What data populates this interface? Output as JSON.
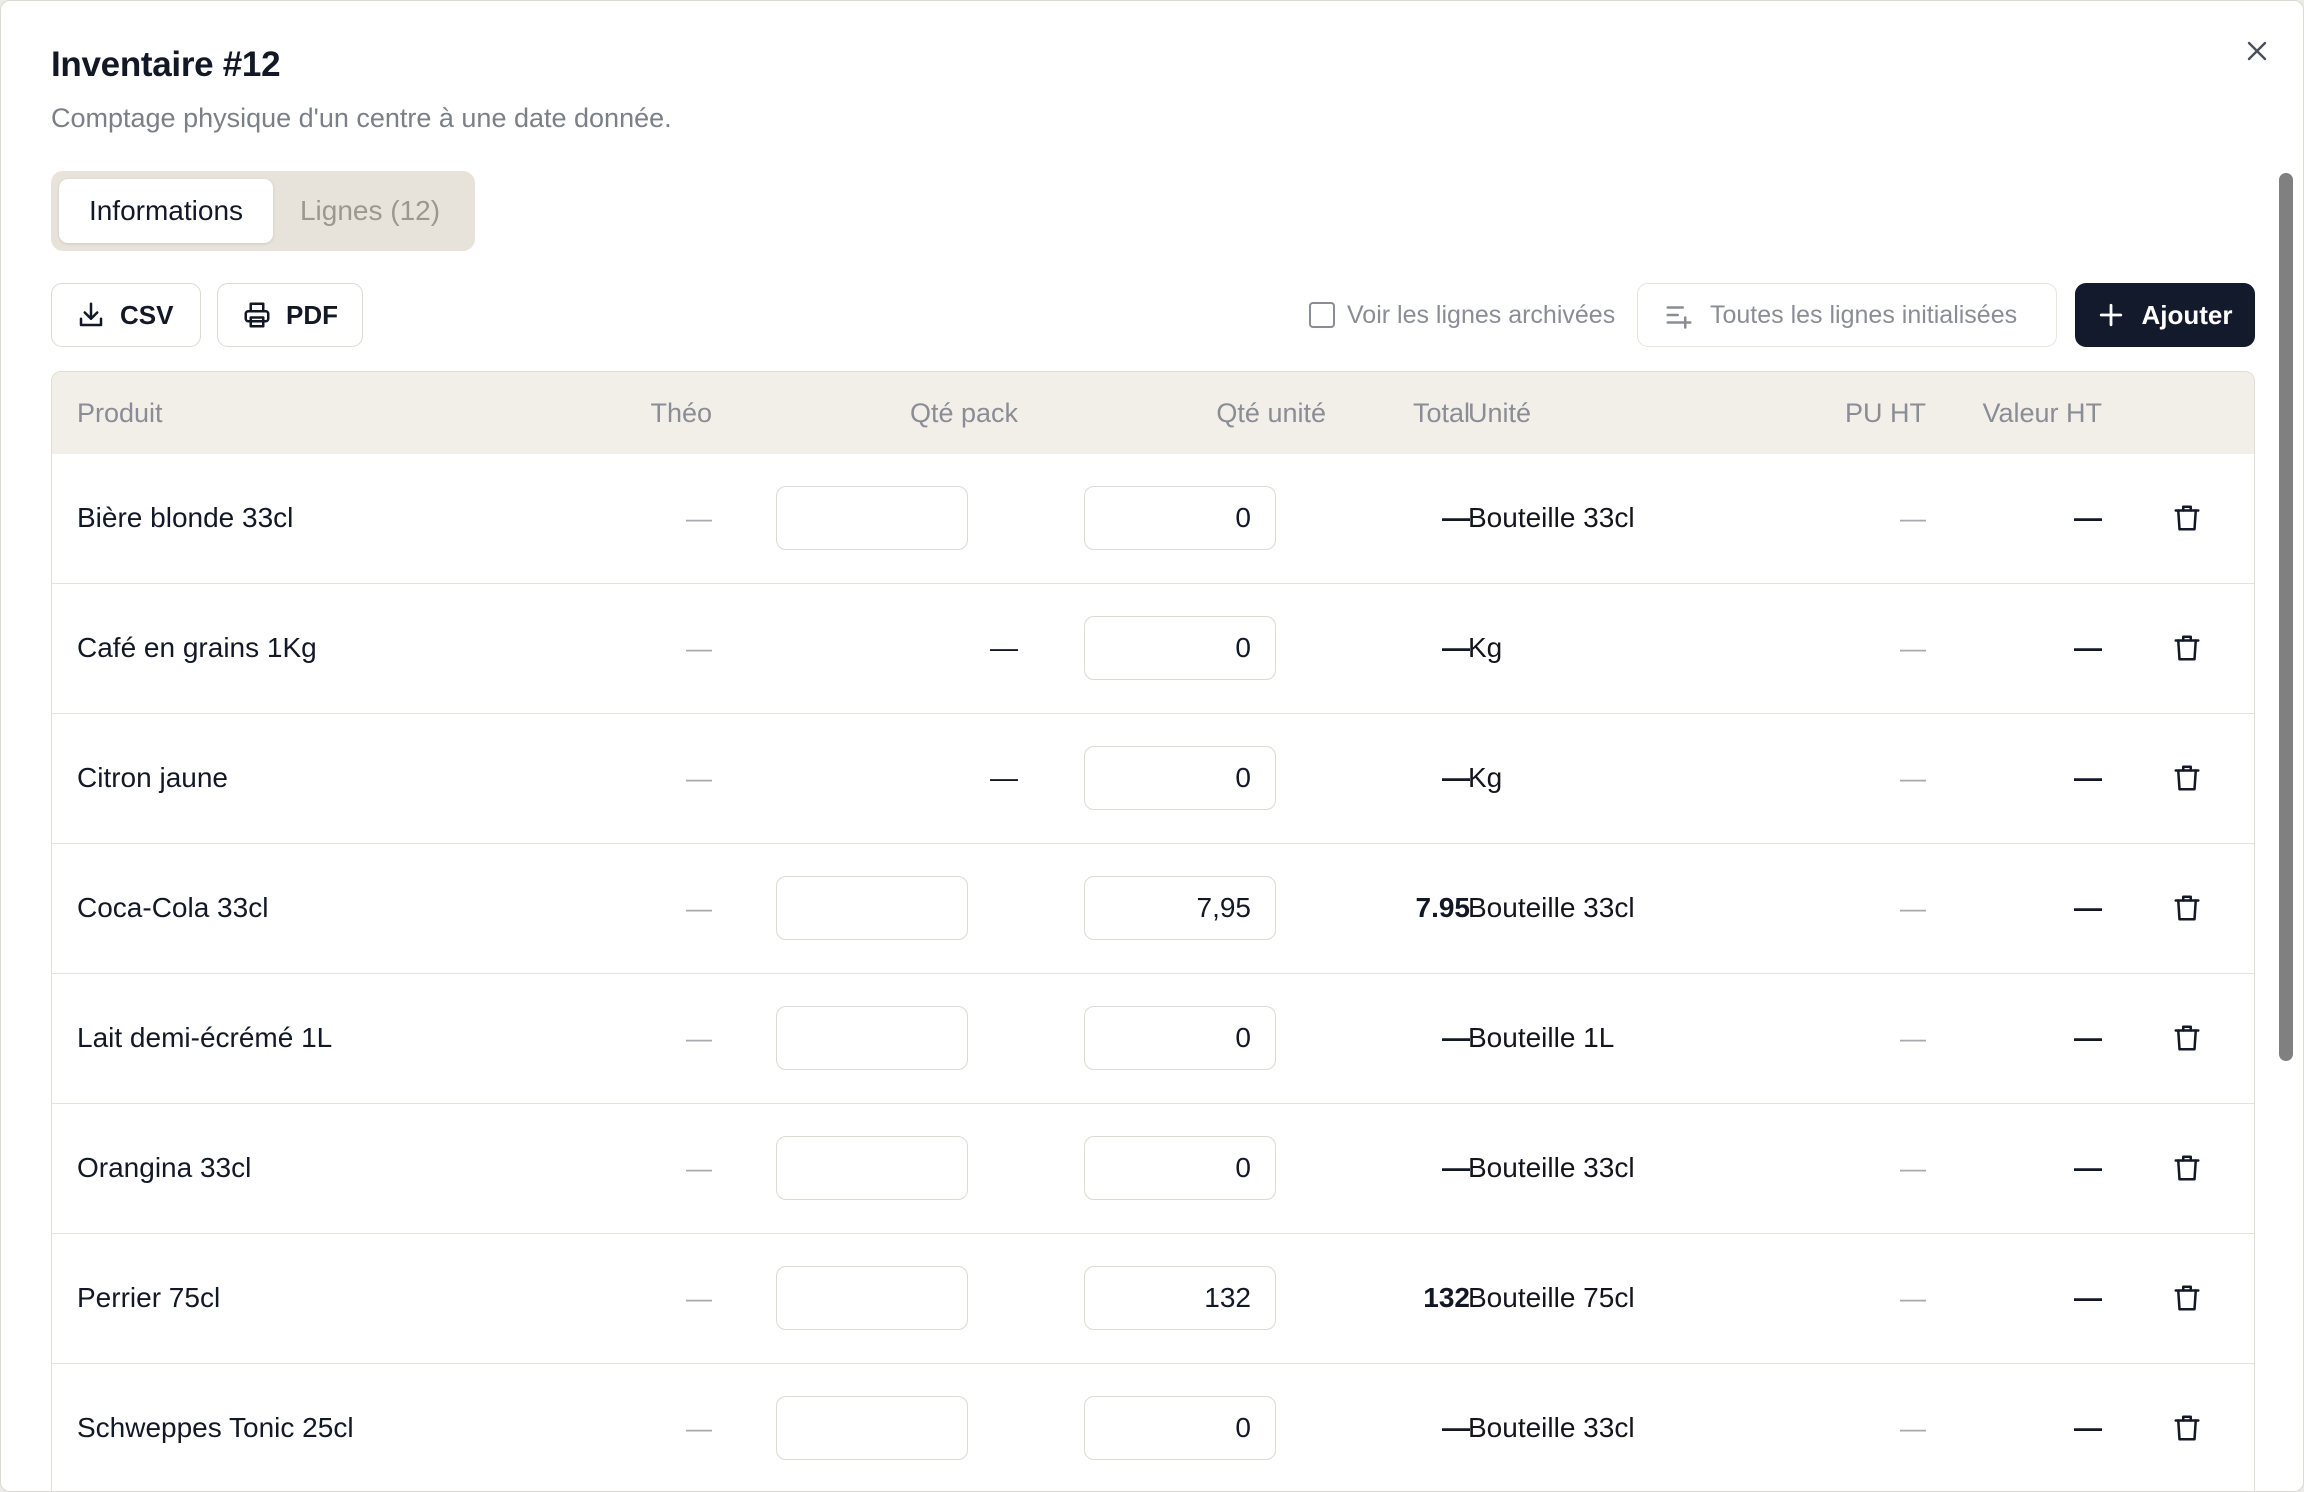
{
  "dialog": {
    "title": "Inventaire #12",
    "subtitle": "Comptage physique d'un centre à une date donnée."
  },
  "tabs": [
    {
      "label": "Informations",
      "active": true
    },
    {
      "label": "Lignes (12)",
      "active": false
    }
  ],
  "toolbar": {
    "csv_label": "CSV",
    "pdf_label": "PDF",
    "archived_label": "Voir les lignes archivées",
    "archived_checked": false,
    "filter_label": "Toutes les lignes initialisées",
    "add_label": "Ajouter"
  },
  "table": {
    "columns": [
      "Produit",
      "Théo",
      "Qté pack",
      "Qté unité",
      "Total",
      "Unité",
      "PU HT",
      "Valeur HT"
    ],
    "rows": [
      {
        "product": "Bière blonde 33cl",
        "theo": "—",
        "pack": "",
        "unit_qty": "0",
        "total": "—",
        "unit": "Bouteille 33cl",
        "pu_ht": "—",
        "valeur_ht": "—"
      },
      {
        "product": "Café en grains 1Kg",
        "theo": "—",
        "pack": "—",
        "unit_qty": "0",
        "total": "—",
        "unit": "Kg",
        "pu_ht": "—",
        "valeur_ht": "—"
      },
      {
        "product": "Citron jaune",
        "theo": "—",
        "pack": "—",
        "unit_qty": "0",
        "total": "—",
        "unit": "Kg",
        "pu_ht": "—",
        "valeur_ht": "—"
      },
      {
        "product": "Coca-Cola 33cl",
        "theo": "—",
        "pack": "",
        "unit_qty": "7,95",
        "total": "7.95",
        "unit": "Bouteille 33cl",
        "pu_ht": "—",
        "valeur_ht": "—"
      },
      {
        "product": "Lait demi-écrémé 1L",
        "theo": "—",
        "pack": "",
        "unit_qty": "0",
        "total": "—",
        "unit": "Bouteille 1L",
        "pu_ht": "—",
        "valeur_ht": "—"
      },
      {
        "product": "Orangina 33cl",
        "theo": "—",
        "pack": "",
        "unit_qty": "0",
        "total": "—",
        "unit": "Bouteille 33cl",
        "pu_ht": "—",
        "valeur_ht": "—"
      },
      {
        "product": "Perrier 75cl",
        "theo": "—",
        "pack": "",
        "unit_qty": "132",
        "total": "132",
        "unit": "Bouteille 75cl",
        "pu_ht": "—",
        "valeur_ht": "—"
      },
      {
        "product": "Schweppes Tonic 25cl",
        "theo": "—",
        "pack": "",
        "unit_qty": "0",
        "total": "—",
        "unit": "Bouteille 33cl",
        "pu_ht": "—",
        "valeur_ht": "—"
      }
    ]
  },
  "icons": {
    "close": "close-icon",
    "csv": "download-icon",
    "pdf": "printer-icon",
    "filter": "list-filter-icon",
    "add": "plus-icon",
    "row_action": "trash-icon"
  }
}
